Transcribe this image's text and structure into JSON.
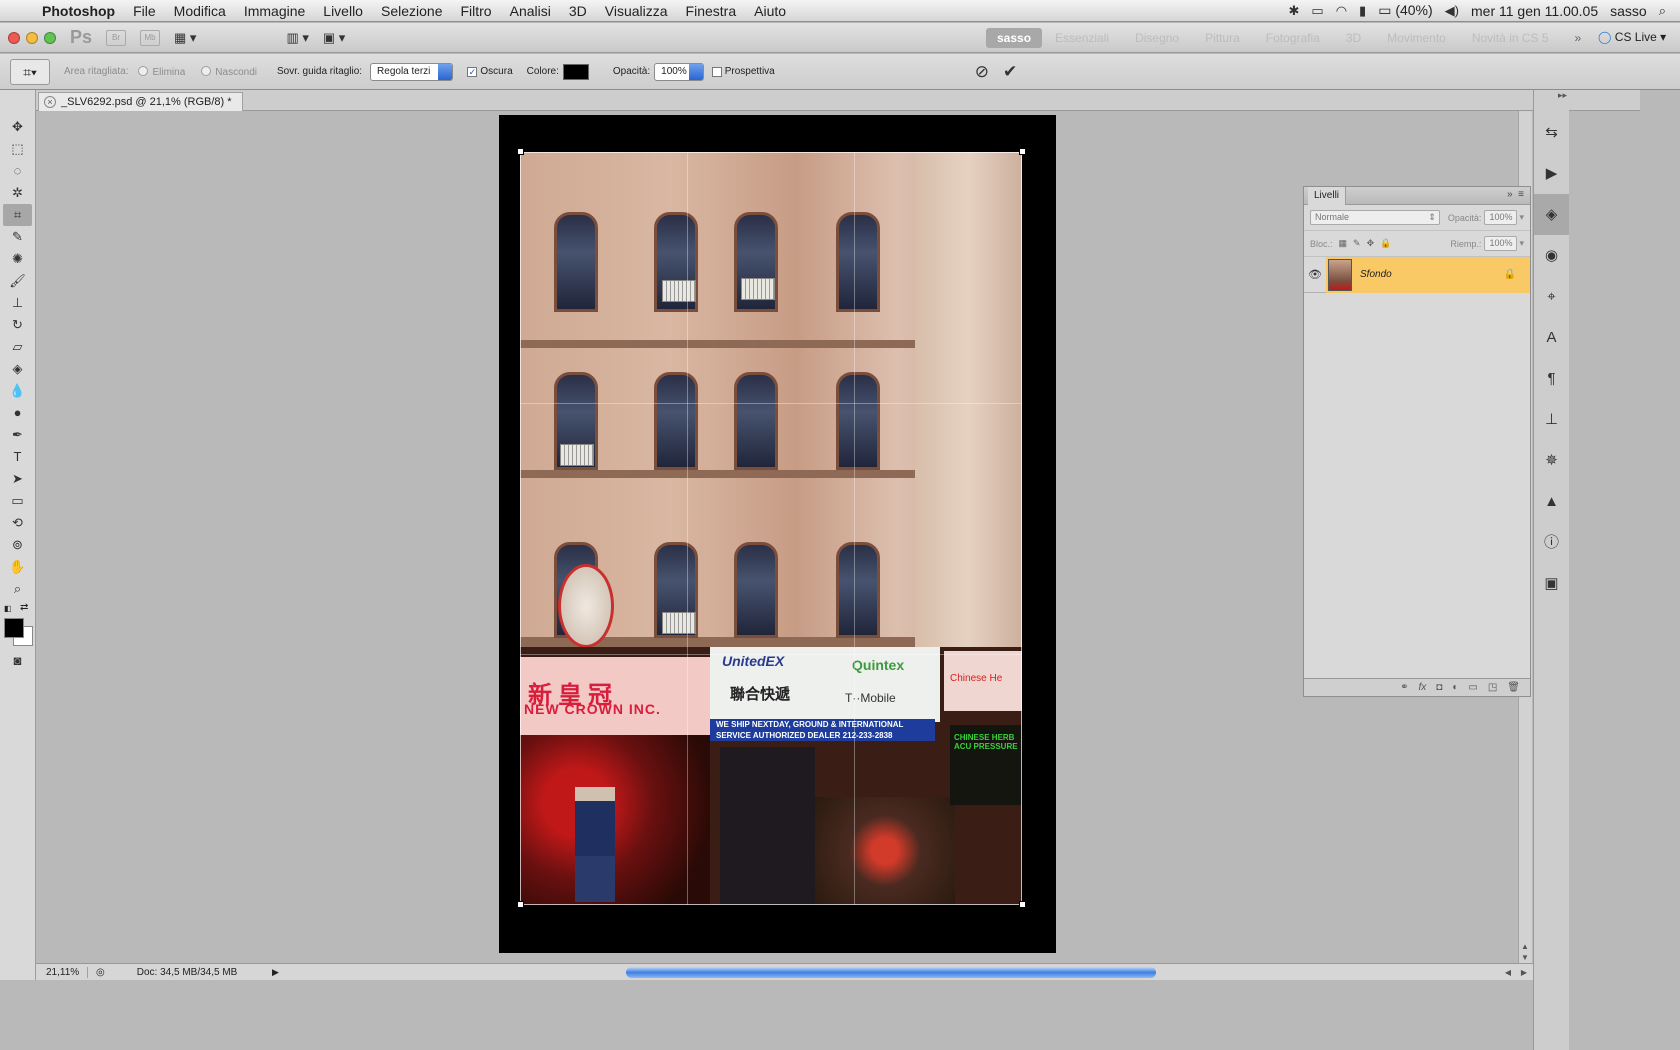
{
  "menubar": {
    "app": "Photoshop",
    "items": [
      "File",
      "Modifica",
      "Immagine",
      "Livello",
      "Selezione",
      "Filtro",
      "Analisi",
      "3D",
      "Visualizza",
      "Finestra",
      "Aiuto"
    ],
    "battery": "(40%)",
    "clock": "mer 11 gen  11.00.05",
    "user": "sasso"
  },
  "appbar": {
    "ps_label": "Ps",
    "br_label": "Br",
    "mb_label": "Mb",
    "workspaces_active": "sasso",
    "workspaces": [
      "Essenziali",
      "Disegno",
      "Pittura",
      "Fotografia",
      "3D",
      "Movimento",
      "Novità in CS 5"
    ],
    "cs_live": "CS Live"
  },
  "options": {
    "area_label": "Area ritagliata:",
    "elimina": "Elimina",
    "nascondi": "Nascondi",
    "overlay_label": "Sovr. guida ritaglio:",
    "overlay_value": "Regola terzi",
    "oscura": "Oscura",
    "colore": "Colore:",
    "opacita_label": "Opacità:",
    "opacita_value": "100%",
    "prospettiva": "Prospettiva"
  },
  "document": {
    "tab_title": "_SLV6292.psd @ 21,1% (RGB/8) *"
  },
  "layers_panel": {
    "title": "Livelli",
    "blend_mode": "Normale",
    "opacity_label": "Opacità:",
    "opacity_value": "100%",
    "lock_label": "Bloc.:",
    "fill_label": "Riemp.:",
    "fill_value": "100%",
    "layer_name": "Sfondo"
  },
  "statusbar": {
    "zoom": "21,11%",
    "doc_info": "Doc: 34,5 MB/34,5 MB"
  },
  "photo": {
    "sign_chinese_1": "新皇冠",
    "sign_new_crown": "NEW CROWN INC.",
    "sign_unitedex": "UnitedEX",
    "sign_quintex": "Quintex",
    "sign_chinese_2": "聯合快遞",
    "sign_tmobile": "T··Mobile",
    "sign_blue": "WE SHIP NEXTDAY, GROUND & INTERNATIONAL SERVICE   AUTHORIZED DEALER 212-233-2838",
    "sign_herb": "Chinese He",
    "sign_neon": "CHINESE HERB ACU PRESSURE"
  },
  "colors": {
    "selected_layer": "#f9c965",
    "accent_blue": "#2b64d0"
  }
}
